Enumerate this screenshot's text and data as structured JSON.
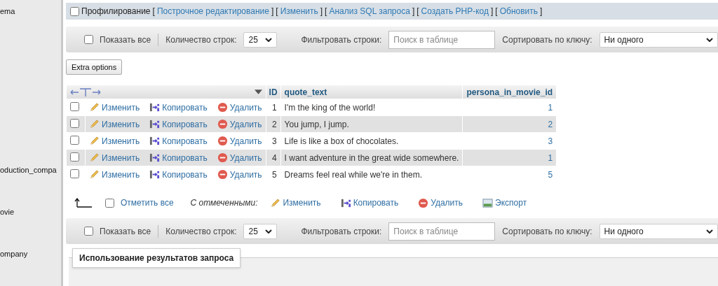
{
  "sidebar": {
    "items": [
      {
        "label": "ema"
      },
      {
        "label": "oduction_compa"
      },
      {
        "label": "ovie"
      },
      {
        "label": "ompany"
      }
    ]
  },
  "profiling": {
    "checked": false,
    "label": "Профилирование",
    "links": [
      {
        "open": "[",
        "label": "Построчное редактирование",
        "close": "]"
      },
      {
        "open": "[",
        "label": "Изменить",
        "close": "]"
      },
      {
        "open": "[",
        "label": "Анализ SQL запроса",
        "close": "]"
      },
      {
        "open": "[",
        "label": "Создать PHP-код",
        "close": "]"
      },
      {
        "open": "[",
        "label": "Обновить",
        "close": "]"
      }
    ]
  },
  "nav_bars": [
    {
      "show_all_label": "Показать все",
      "show_all_checked": false,
      "rows_label": "Количество строк:",
      "rows_value": "25",
      "filter_label": "Фильтровать строки:",
      "filter_placeholder": "Поиск в таблице",
      "sort_label": "Сортировать по ключу:",
      "sort_value": "Ни одного"
    },
    {
      "show_all_label": "Показать все",
      "show_all_checked": false,
      "rows_label": "Количество строк:",
      "rows_value": "25",
      "filter_label": "Фильтровать строки:",
      "filter_placeholder": "Поиск в таблице",
      "sort_label": "Сортировать по ключу:",
      "sort_value": "Ни одного"
    }
  ],
  "extra_options_button": "Extra options",
  "table": {
    "columns": [
      "ID",
      "quote_text",
      "persona_in_movie_id"
    ],
    "rows": [
      {
        "checked": false,
        "actions": [
          {
            "kind": "edit",
            "label": "Изменить"
          },
          {
            "kind": "copy",
            "label": "Копировать"
          },
          {
            "kind": "delete",
            "label": "Удалить"
          }
        ],
        "cells": [
          "1",
          "I'm the king of the world!",
          "1"
        ]
      },
      {
        "checked": false,
        "actions": [
          {
            "kind": "edit",
            "label": "Изменить"
          },
          {
            "kind": "copy",
            "label": "Копировать"
          },
          {
            "kind": "delete",
            "label": "Удалить"
          }
        ],
        "cells": [
          "2",
          "You jump, I jump.",
          "2"
        ]
      },
      {
        "checked": false,
        "actions": [
          {
            "kind": "edit",
            "label": "Изменить"
          },
          {
            "kind": "copy",
            "label": "Копировать"
          },
          {
            "kind": "delete",
            "label": "Удалить"
          }
        ],
        "cells": [
          "3",
          "Life is like a box of chocolates.",
          "3"
        ]
      },
      {
        "checked": false,
        "actions": [
          {
            "kind": "edit",
            "label": "Изменить"
          },
          {
            "kind": "copy",
            "label": "Копировать"
          },
          {
            "kind": "delete",
            "label": "Удалить"
          }
        ],
        "cells": [
          "4",
          "I want adventure in the great wide somewhere.",
          "1"
        ]
      },
      {
        "checked": false,
        "actions": [
          {
            "kind": "edit",
            "label": "Изменить"
          },
          {
            "kind": "copy",
            "label": "Копировать"
          },
          {
            "kind": "delete",
            "label": "Удалить"
          }
        ],
        "cells": [
          "5",
          "Dreams feel real while we're in them.",
          "5"
        ]
      }
    ]
  },
  "bulk": {
    "check_all_checked": false,
    "check_all_label": "Отметить все",
    "with_selected_label": "С отмеченными:",
    "actions": [
      {
        "kind": "edit",
        "label": "Изменить"
      },
      {
        "kind": "copy",
        "label": "Копировать"
      },
      {
        "kind": "delete",
        "label": "Удалить"
      },
      {
        "kind": "export",
        "label": "Экспорт"
      }
    ]
  },
  "query_results_legend": "Использование результатов запроса"
}
